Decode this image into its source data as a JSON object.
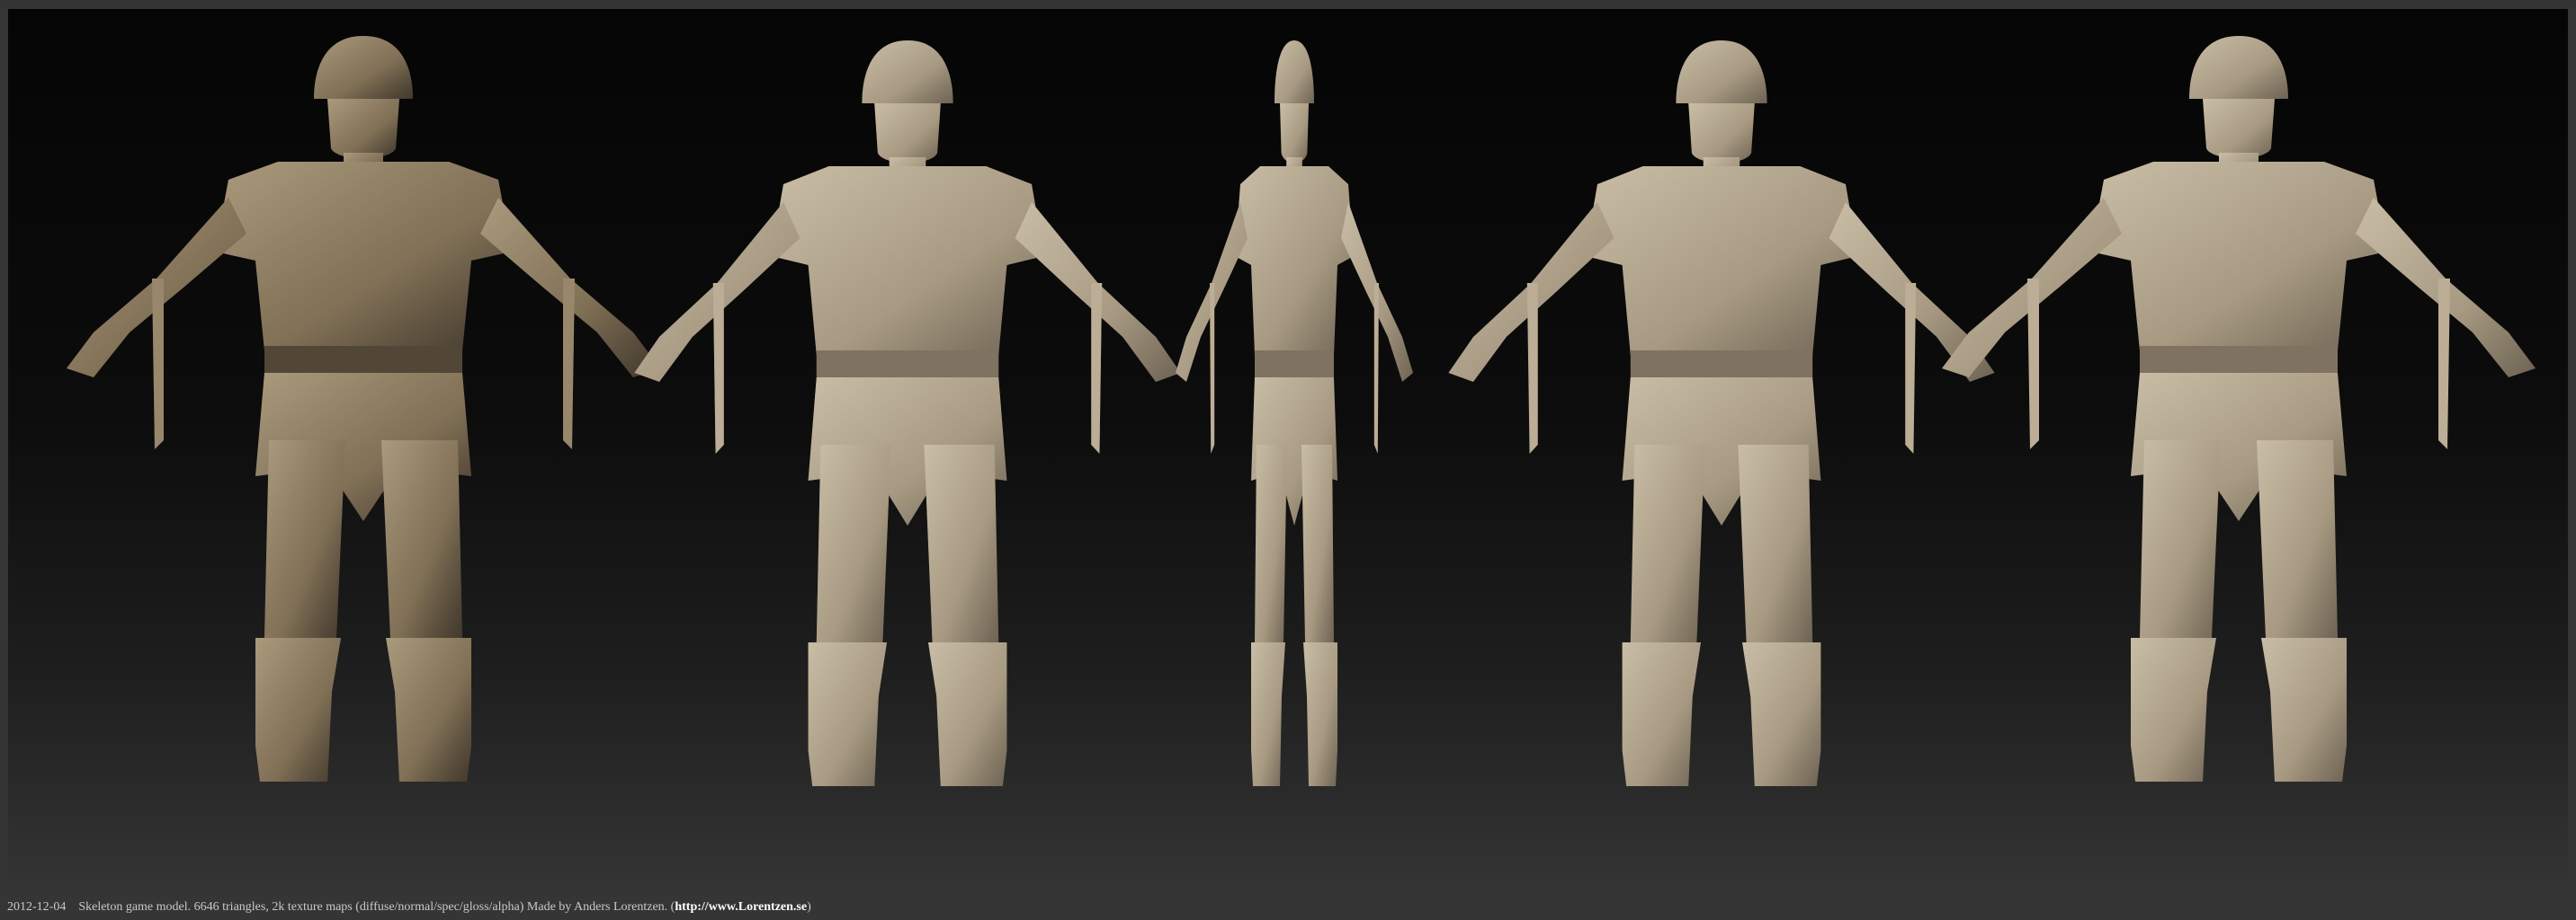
{
  "caption": {
    "date": "2012-12-04",
    "text": "Skeleton game model. 6646 triangles, 2k texture maps (diffuse/normal/spec/gloss/alpha) Made by Anders Lorentzen. (",
    "link": "http://www.Lorentzen.se",
    "close": ")"
  },
  "colors": {
    "background_top": "#050505",
    "background_bottom": "#353535",
    "model_base": "#b8ab95",
    "model_shadow": "#6d6353",
    "wire": "#2a241c"
  },
  "views": [
    {
      "name": "front-view",
      "icon": "skeleton-warrior-front"
    },
    {
      "name": "three-quarter-front-view",
      "icon": "skeleton-warrior-three-quarter"
    },
    {
      "name": "side-view",
      "icon": "skeleton-warrior-side"
    },
    {
      "name": "three-quarter-back-view",
      "icon": "skeleton-warrior-back-three-quarter"
    },
    {
      "name": "back-view",
      "icon": "skeleton-warrior-back"
    }
  ]
}
